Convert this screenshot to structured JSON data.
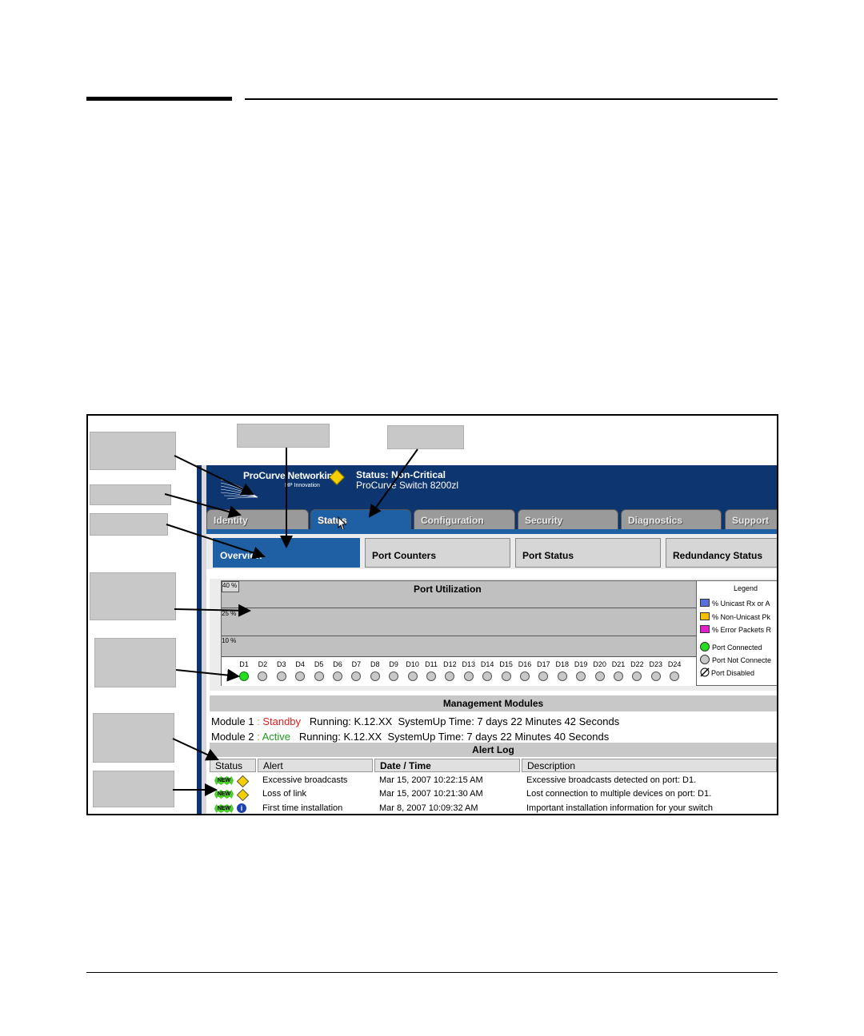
{
  "header": {
    "brand": "ProCurve Networking",
    "brand_sub": "HP Innovation",
    "status": "Status: Non-Critical",
    "device": "ProCurve Switch 8200zl"
  },
  "tabs": [
    "Identity",
    "Status",
    "Configuration",
    "Security",
    "Diagnostics",
    "Support"
  ],
  "subtabs": [
    "Overview",
    "Port Counters",
    "Port Status",
    "Redundancy Status"
  ],
  "chart_data": {
    "type": "bar",
    "title": "Port Utilization",
    "ytick_labels": [
      "40 %",
      "25 %",
      "10 %"
    ],
    "categories": [
      "D1",
      "D2",
      "D3",
      "D4",
      "D5",
      "D6",
      "D7",
      "D8",
      "D9",
      "D10",
      "D11",
      "D12",
      "D13",
      "D14",
      "D15",
      "D16",
      "D17",
      "D18",
      "D19",
      "D20",
      "D21",
      "D22",
      "D23",
      "D24"
    ],
    "port_connected": [
      true,
      false,
      false,
      false,
      false,
      false,
      false,
      false,
      false,
      false,
      false,
      false,
      false,
      false,
      false,
      false,
      false,
      false,
      false,
      false,
      false,
      false,
      false,
      false
    ],
    "legend_title": "Legend",
    "legend": [
      {
        "label": "% Unicast Rx or A",
        "color": "#5b6fd8"
      },
      {
        "label": "% Non-Unicast Pk",
        "color": "#f5c000"
      },
      {
        "label": "% Error Packets R",
        "color": "#e020c8"
      }
    ],
    "status_legend": [
      "Port Connected",
      "Port Not Connecte",
      "Port Disabled"
    ]
  },
  "management_modules": {
    "title": "Management Modules",
    "modules": [
      {
        "name": "Module 1",
        "sep": " : ",
        "state": "Standby",
        "running": "Running: K.12.XX",
        "uptime": "SystemUp Time: 7 days 22 Minutes 42 Seconds"
      },
      {
        "name": "Module 2",
        "sep": " : ",
        "state": "Active",
        "running": "Running: K.12.XX",
        "uptime": "SystemUp Time: 7 days 22 Minutes 40 Seconds"
      }
    ]
  },
  "alert_log": {
    "title": "Alert Log",
    "columns": [
      "Status",
      "Alert",
      "Date / Time",
      "Description"
    ],
    "new_label": "NEW",
    "rows": [
      {
        "icon": "warning-icon",
        "alert": "Excessive broadcasts",
        "datetime": "Mar 15, 2007 10:22:15 AM",
        "description": "Excessive broadcasts detected on port: D1."
      },
      {
        "icon": "warning-icon",
        "alert": "Loss of link",
        "datetime": "Mar 15, 2007 10:21:30 AM",
        "description": "Lost connection to multiple devices on port: D1."
      },
      {
        "icon": "info-icon",
        "alert": "First time installation",
        "datetime": "Mar 8, 2007 10:09:32 AM",
        "description": "Important installation information for your switch"
      }
    ]
  },
  "colors": {
    "header_blue": "#0d3570",
    "tab_active": "#1f5fa3",
    "standby": "#dd2020",
    "active": "#1f9a1f",
    "port_connected": "#22dd22"
  }
}
